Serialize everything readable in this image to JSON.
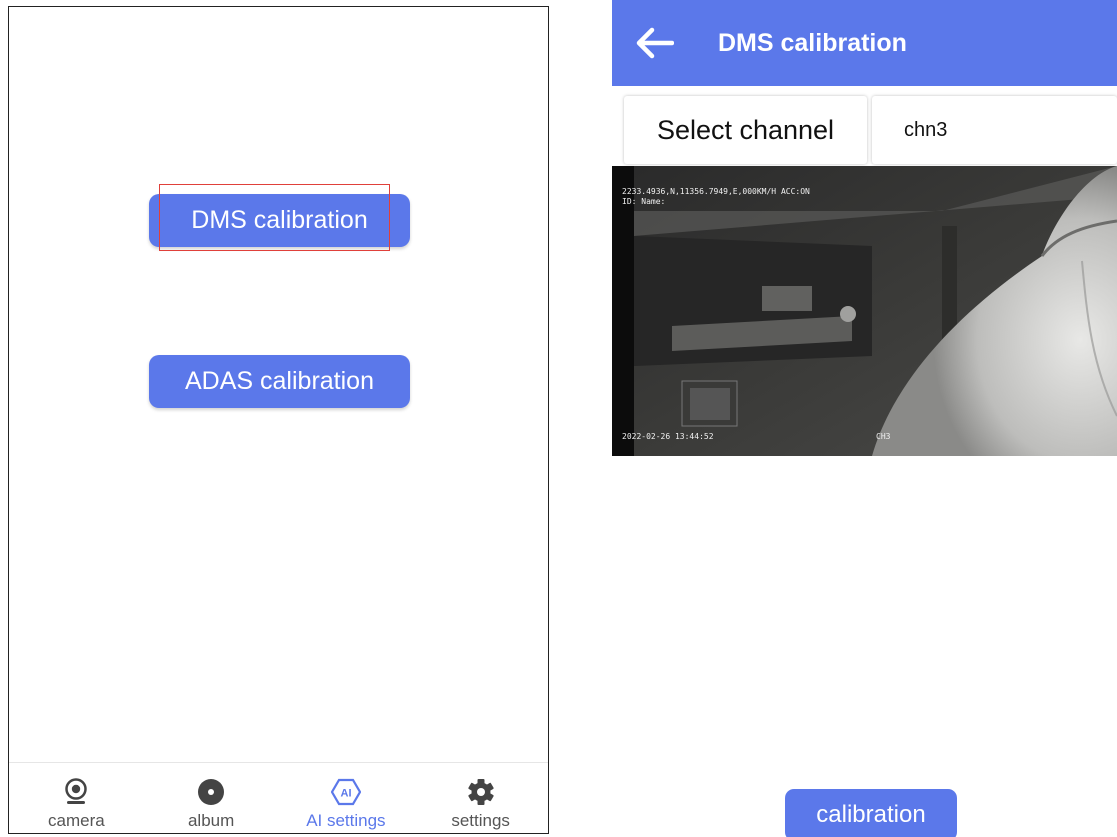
{
  "main_menu": {
    "dms_button": "DMS calibration",
    "adas_button": "ADAS calibration"
  },
  "tabbar": {
    "camera": "camera",
    "album": "album",
    "ai_settings": "AI settings",
    "settings": "settings",
    "active_tab": "AI settings"
  },
  "dms_screen": {
    "title": "DMS calibration",
    "select_channel_label": "Select channel",
    "channel_value": "chn3",
    "video_overlay": {
      "coords": "2233.4936,N,11356.7949,E,000KM/H ACC:ON",
      "id_line": "ID: Name:",
      "timestamp": "2022-02-26 13:44:52",
      "channel_tag": "CH3"
    },
    "calibration_button": "calibration"
  },
  "colors": {
    "accent": "#5b78ea",
    "highlight": "#e0403a"
  }
}
